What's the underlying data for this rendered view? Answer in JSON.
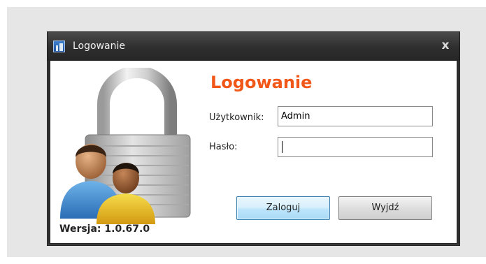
{
  "window": {
    "title": "Logowanie",
    "close_label": "x"
  },
  "dialog": {
    "heading": "Logowanie",
    "username_label": "Użytkownik:",
    "username_value": "Admin",
    "password_label": "Hasło:",
    "password_value": "",
    "login_button": "Zaloguj",
    "exit_button": "Wyjdź",
    "version": "Wersja: 1.0.67.0"
  },
  "icons": {
    "app": "app-icon",
    "art": "padlock-users-icon"
  },
  "colors": {
    "heading": "#f2571a",
    "titlebar": "#2e2e2e",
    "primary_button": "#bee6fd"
  }
}
